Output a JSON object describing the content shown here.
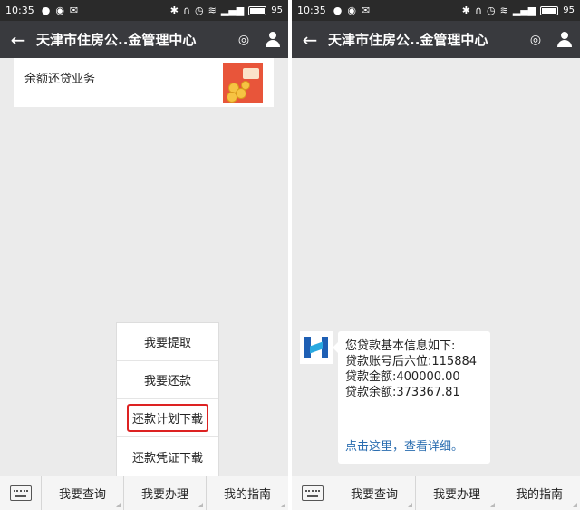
{
  "left": {
    "status": {
      "time": "10:35",
      "battery": "95"
    },
    "nav": {
      "title": "天津市住房公..金管理中心"
    },
    "card": {
      "label": "余额还贷业务"
    },
    "popup": {
      "items": [
        "我要提取",
        "我要还款",
        "还款计划下载",
        "还款凭证下载"
      ],
      "highlighted_index": 2,
      "highlight_color": "#dd2222"
    },
    "bottom": {
      "menus": [
        "我要查询",
        "我要办理",
        "我的指南"
      ]
    }
  },
  "right": {
    "status": {
      "time": "10:35",
      "battery": "95"
    },
    "nav": {
      "title": "天津市住房公..金管理中心"
    },
    "message": {
      "lines": [
        "您贷款基本信息如下:",
        "贷款账号后六位:115884",
        "贷款金额:400000.00",
        "贷款余额:373367.81"
      ],
      "link": "点击这里，查看详细。"
    },
    "bottom": {
      "menus": [
        "我要查询",
        "我要办理",
        "我的指南"
      ]
    }
  },
  "colors": {
    "navbar": "#393a3e",
    "statusbar": "#2a2a2a",
    "background": "#ebebeb",
    "link": "#2a6db0"
  }
}
